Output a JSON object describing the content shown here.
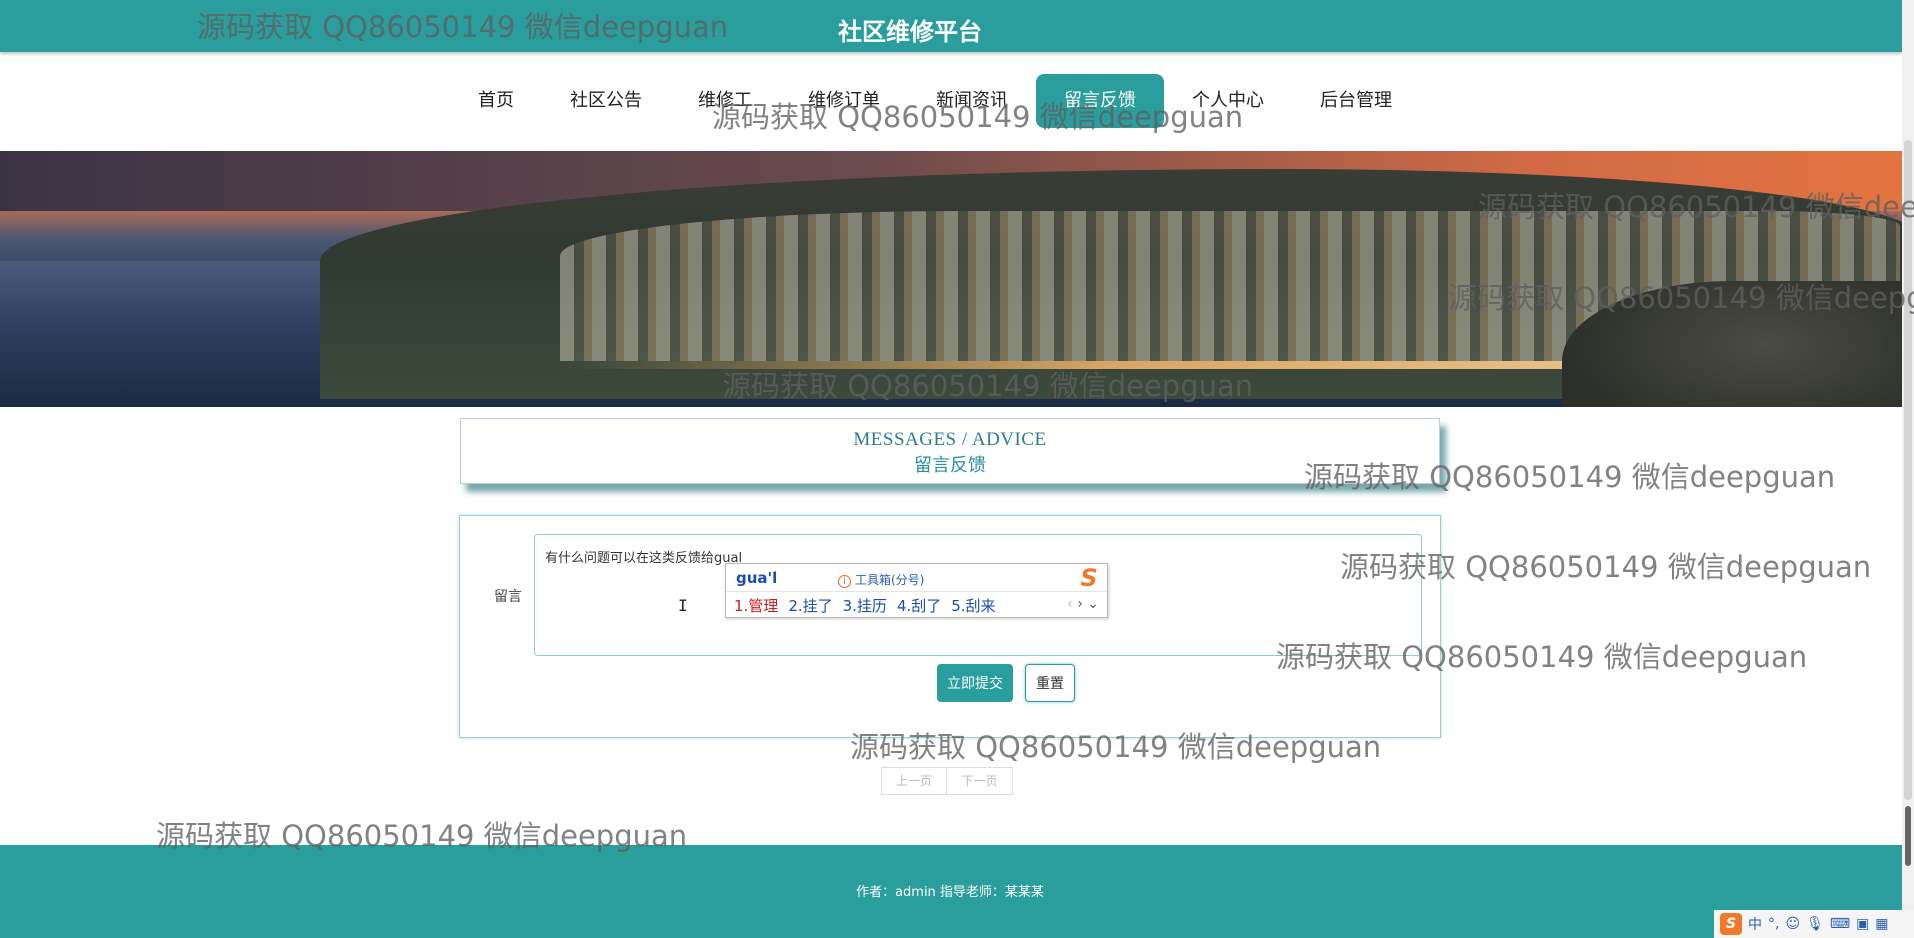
{
  "header": {
    "title": "社区维修平台"
  },
  "nav": {
    "items": [
      {
        "label": "首页"
      },
      {
        "label": "社区公告"
      },
      {
        "label": "维修工"
      },
      {
        "label": "维修订单"
      },
      {
        "label": "新闻资讯"
      },
      {
        "label": "留言反馈",
        "active": true
      },
      {
        "label": "个人中心"
      },
      {
        "label": "后台管理"
      }
    ]
  },
  "section": {
    "title_en": "MESSAGES / ADVICE",
    "title_cn": "留言反馈"
  },
  "form": {
    "label": "留言",
    "textarea_value": "有什么问题可以在这类反馈给gual",
    "submit_label": "立即提交",
    "reset_label": "重置"
  },
  "ime": {
    "composition": "gua'l",
    "toolbox": "工具箱(分号)",
    "candidates": [
      "1.管理",
      "2.挂了",
      "3.挂历",
      "4.刮了",
      "5.刮来"
    ]
  },
  "pager": {
    "prev": "上一页",
    "next": "下一页"
  },
  "footer": {
    "text": "作者：admin 指导老师：某某某"
  },
  "tray": {
    "lang": "中"
  },
  "watermark": {
    "text": "源码获取 QQ86050149 微信deepguan"
  },
  "colors": {
    "primary": "#2a9d9d",
    "white": "#ffffff",
    "ime_blue": "#1a4ea8",
    "ime_red": "#c8201e"
  }
}
